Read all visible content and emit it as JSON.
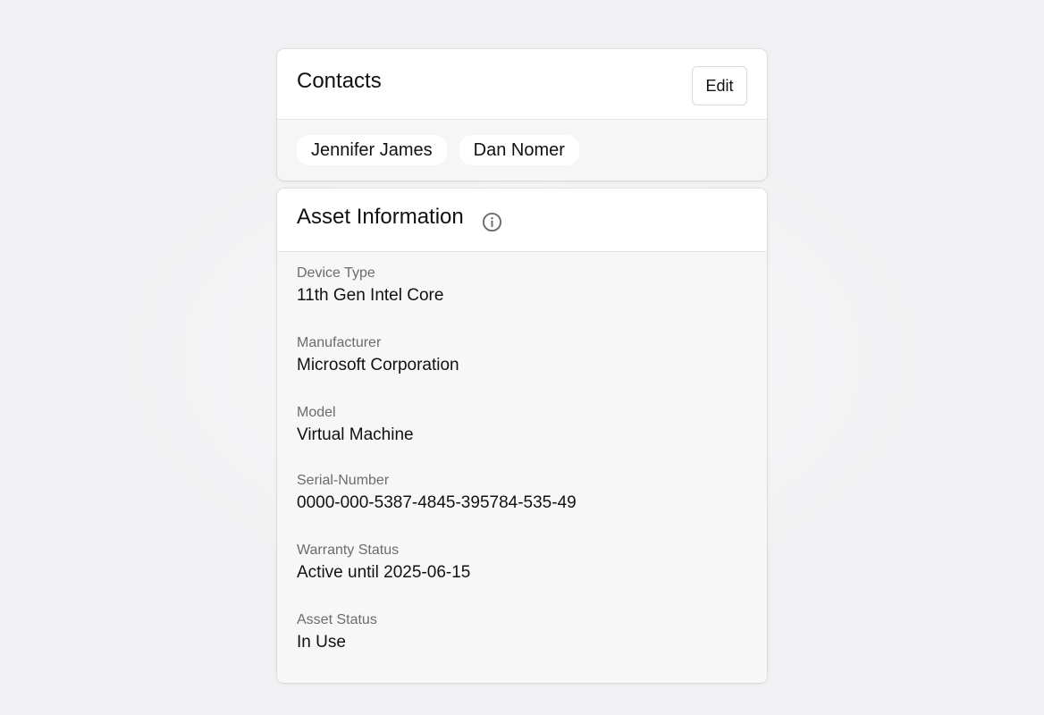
{
  "contacts": {
    "title": "Contacts",
    "edit_label": "Edit",
    "people": [
      "Jennifer James",
      "Dan Nomer"
    ]
  },
  "asset": {
    "title": "Asset Information",
    "info_icon": "info-icon",
    "fields": [
      {
        "label": "Device Type",
        "value": "11th Gen Intel Core"
      },
      {
        "label": "Manufacturer",
        "value": "Microsoft Corporation"
      },
      {
        "label": "Model",
        "value": "Virtual Machine"
      },
      {
        "label": "Serial-Number",
        "value": "0000-000-5387-4845-395784-535-49"
      },
      {
        "label": "Warranty Status",
        "value": "Active until 2025-06-15"
      },
      {
        "label": "Asset Status",
        "value": "In Use"
      }
    ]
  }
}
